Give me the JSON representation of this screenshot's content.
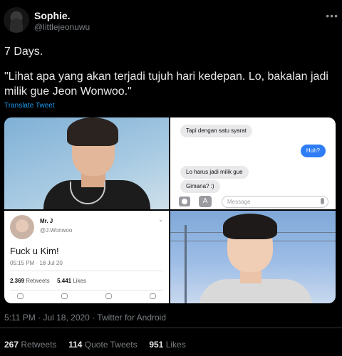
{
  "author": {
    "name": "Sophie.",
    "handle": "@littlejeonuwu",
    "more_icon": "more-icon"
  },
  "tweet": {
    "line1": "7 Days.",
    "line2": "\"Lihat apa yang akan terjadi tujuh hari kedepan. Lo, bakalan jadi milik gue Jeon Wonwoo.\"",
    "translate_label": "Translate Tweet"
  },
  "chat": {
    "messages": [
      {
        "text": "Tapi dengan satu syarat",
        "from": "them"
      },
      {
        "text": "Huh?",
        "from": "me"
      },
      {
        "text": "Lo harus jadi milik gue",
        "from": "them"
      },
      {
        "text": "Gimana? :)",
        "from": "them"
      }
    ],
    "input_placeholder": "Message",
    "colors": {
      "sent": "#2f7df6",
      "received": "#e9e9eb"
    }
  },
  "embedded_tweet": {
    "name": "Mr. J",
    "handle": "@J.Wonwoo",
    "text": "Fuck u Kim!",
    "time": "05:15 PM · 18 Jul 20",
    "retweets": "2.369",
    "retweets_label": "Retweets",
    "likes": "5.441",
    "likes_label": "Likes"
  },
  "meta": {
    "timestamp": "5:11 PM · Jul 18, 2020 · Twitter for Android"
  },
  "stats": {
    "retweets": "267",
    "retweets_label": "Retweets",
    "quotes": "114",
    "quotes_label": "Quote Tweets",
    "likes": "951",
    "likes_label": "Likes"
  },
  "colors": {
    "background": "#000000",
    "link": "#1d9bf0",
    "secondary_text": "#7a7f83"
  }
}
